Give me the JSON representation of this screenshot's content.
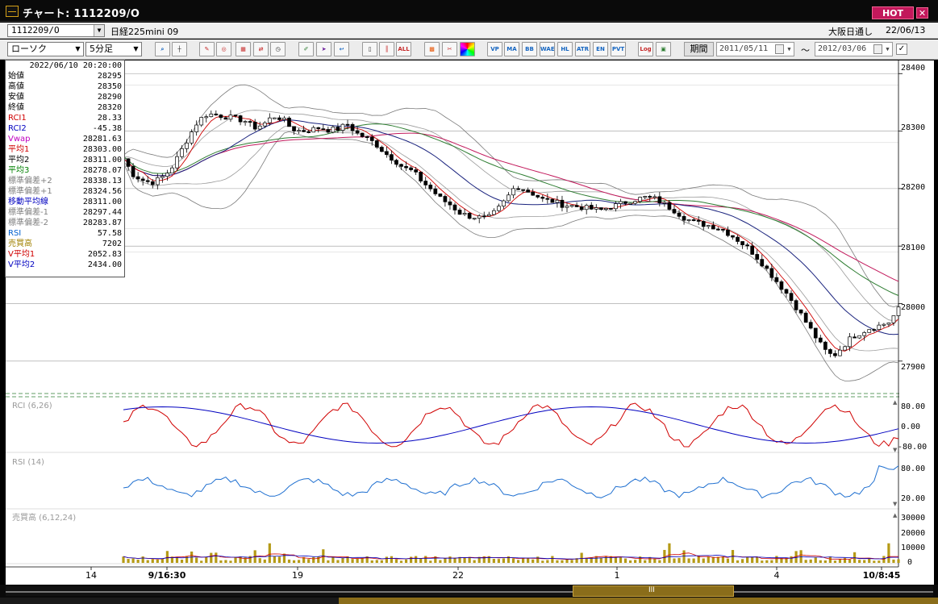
{
  "window": {
    "title": "チャート: 1112209/O",
    "hot_label": "HOT",
    "close_label": "✕"
  },
  "header": {
    "symbol_value": "1112209/O",
    "instrument": "日経225mini 09",
    "session": "大阪日通し",
    "date": "22/06/13"
  },
  "toolbar": {
    "chart_type": "ローソク",
    "interval": "5分足",
    "period_label": "期間",
    "date_from": "2011/05/11",
    "date_to": "2012/03/06",
    "tilde": "〜",
    "buttons": [
      "search-icon",
      "crosshair-icon",
      "draw-icon",
      "circle-icon",
      "grid-icon",
      "refresh-icon",
      "pen-icon",
      "cursor-icon",
      "arrow-icon",
      "candle-icon",
      "bar-icon",
      "all-icon",
      "pattern-icon",
      "brush-icon",
      "color-icon"
    ],
    "indicators": [
      "VP",
      "MA",
      "BB",
      "WAE",
      "HL",
      "ATR",
      "EN",
      "PVT",
      "Log"
    ]
  },
  "databox": {
    "datetime": "2022/06/10  20:20:00",
    "rows": [
      {
        "label": "始値",
        "value": "28295",
        "color": "#000000"
      },
      {
        "label": "高値",
        "value": "28350",
        "color": "#000000"
      },
      {
        "label": "安値",
        "value": "28290",
        "color": "#000000"
      },
      {
        "label": "終値",
        "value": "28320",
        "color": "#000000"
      },
      {
        "label": "RCI1",
        "value": "28.33",
        "color": "#d00000"
      },
      {
        "label": "RCI2",
        "value": "-45.38",
        "color": "#0000c0"
      },
      {
        "label": "Vwap",
        "value": "28281.63",
        "color": "#c000c0"
      },
      {
        "label": "平均1",
        "value": "28303.00",
        "color": "#d00000"
      },
      {
        "label": "平均2",
        "value": "28311.00",
        "color": "#000000"
      },
      {
        "label": "平均3",
        "value": "28278.07",
        "color": "#008000"
      },
      {
        "label": "標準偏差+2",
        "value": "28338.13",
        "color": "#808080"
      },
      {
        "label": "標準偏差+1",
        "value": "28324.56",
        "color": "#808080"
      },
      {
        "label": "移動平均線",
        "value": "28311.00",
        "color": "#0000c0"
      },
      {
        "label": "標準偏差-1",
        "value": "28297.44",
        "color": "#808080"
      },
      {
        "label": "標準偏差-2",
        "value": "28283.87",
        "color": "#808080"
      },
      {
        "label": "RSI",
        "value": "57.58",
        "color": "#0060d0"
      },
      {
        "label": "売買高",
        "value": "7202",
        "color": "#a08000"
      },
      {
        "label": "V平均1",
        "value": "2052.83",
        "color": "#d00000"
      },
      {
        "label": "V平均2",
        "value": "2434.00",
        "color": "#0000c0"
      }
    ]
  },
  "chart_data": [
    {
      "type": "candlestick",
      "panel": "price",
      "yticks": [
        27900,
        28000,
        28100,
        28200,
        28300,
        28400
      ],
      "ylim": [
        27845,
        28420
      ],
      "x_labels": [
        "14",
        "9/16:30",
        "19",
        "22",
        "1",
        "4",
        "10/8:45"
      ],
      "close_path": [
        28252,
        28225,
        28215,
        28210,
        28218,
        28232,
        28260,
        28290,
        28318,
        28330,
        28328,
        28325,
        28322,
        28318,
        28306,
        28312,
        28326,
        28322,
        28304,
        28300,
        28302,
        28306,
        28302,
        28304,
        28312,
        28296,
        28288,
        28278,
        28262,
        28250,
        28236,
        28230,
        28212,
        28198,
        28182,
        28172,
        28158,
        28152,
        28150,
        28148,
        28162,
        28182,
        28205,
        28198,
        28190,
        28180,
        28178,
        28172,
        28170,
        28168,
        28165,
        28162,
        28168,
        28172,
        28178,
        28182,
        28185,
        28182,
        28172,
        28162,
        28150,
        28142,
        28138,
        28135,
        28130,
        28120,
        28108,
        28095,
        28078,
        28058,
        28038,
        28018,
        27995,
        27970,
        27945,
        27920,
        27908,
        27925,
        27942,
        27950,
        27958,
        27962,
        27968,
        27990
      ]
    },
    {
      "type": "line",
      "panel": "RCI (6,26)",
      "yticks": [
        80.0,
        0.0,
        -80.0
      ],
      "series": [
        {
          "name": "RCI1"
        },
        {
          "name": "RCI2"
        }
      ]
    },
    {
      "type": "line",
      "panel": "RSI (14)",
      "yticks": [
        80.0,
        20.0
      ],
      "series": [
        {
          "name": "RSI"
        }
      ]
    },
    {
      "type": "bar",
      "panel": "売買高 (6,12,24)",
      "yticks": [
        30000,
        20000,
        10000,
        0
      ]
    }
  ],
  "panel_labels": {
    "rci": "RCI (6,26)",
    "rsi": "RSI (14)",
    "volume": "売買高 (6,12,24)"
  },
  "ytick_labels": {
    "price": [
      "28400",
      "28300",
      "28200",
      "28100",
      "28000",
      "27900"
    ],
    "rci": [
      "80.00",
      "0.00",
      "-80.00"
    ],
    "rsi": [
      "80.00",
      "20.00"
    ],
    "volume": [
      "30000",
      "20000",
      "10000",
      "0"
    ]
  },
  "scroll": {
    "grip": "III"
  }
}
